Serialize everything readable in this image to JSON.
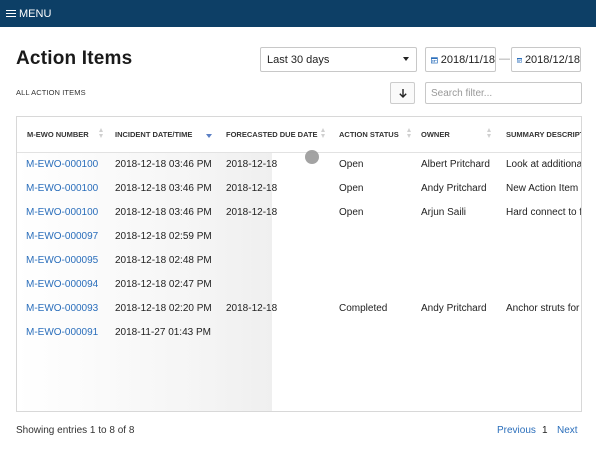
{
  "topbar": {
    "menu_label": "MENU"
  },
  "page": {
    "title": "Action Items",
    "section_label": "ALL ACTION ITEMS"
  },
  "filters": {
    "range": "Last 30 days",
    "date_from": "2018/11/18",
    "date_to": "2018/12/18",
    "separator": "—",
    "search_placeholder": "Search filter..."
  },
  "table": {
    "headers": [
      "M-EWO NUMBER",
      "INCIDENT DATE/TIME",
      "FORECASTED DUE DATE",
      "ACTION STATUS",
      "OWNER",
      "SUMMARY DESCRIPTI"
    ],
    "rows": [
      [
        "M-EWO-000100",
        "2018-12-18 03:46 PM",
        "2018-12-18",
        "Open",
        "Albert Pritchard",
        "Look at additional"
      ],
      [
        "M-EWO-000100",
        "2018-12-18 03:46 PM",
        "2018-12-18",
        "Open",
        "Andy Pritchard",
        "New Action Item"
      ],
      [
        "M-EWO-000100",
        "2018-12-18 03:46 PM",
        "2018-12-18",
        "Open",
        "Arjun Saili",
        "Hard connect to fl"
      ],
      [
        "M-EWO-000097",
        "2018-12-18 02:59 PM",
        "",
        "",
        "",
        ""
      ],
      [
        "M-EWO-000095",
        "2018-12-18 02:48 PM",
        "",
        "",
        "",
        ""
      ],
      [
        "M-EWO-000094",
        "2018-12-18 02:47 PM",
        "",
        "",
        "",
        ""
      ],
      [
        "M-EWO-000093",
        "2018-12-18 02:20 PM",
        "2018-12-18",
        "Completed",
        "Andy Pritchard",
        "Anchor struts for f"
      ],
      [
        "M-EWO-000091",
        "2018-11-27 01:43 PM",
        "",
        "",
        "",
        ""
      ]
    ]
  },
  "footer": {
    "info": "Showing entries 1 to 8 of 8",
    "previous": "Previous",
    "page": "1",
    "next": "Next"
  },
  "colors": {
    "topbar": "#0d3f66",
    "link": "#2a6ebb",
    "sort_active": "#5b7fc4"
  },
  "icons": [
    "menu-icon",
    "calendar-icon",
    "download-icon",
    "sort-icon",
    "sort-desc-icon"
  ]
}
